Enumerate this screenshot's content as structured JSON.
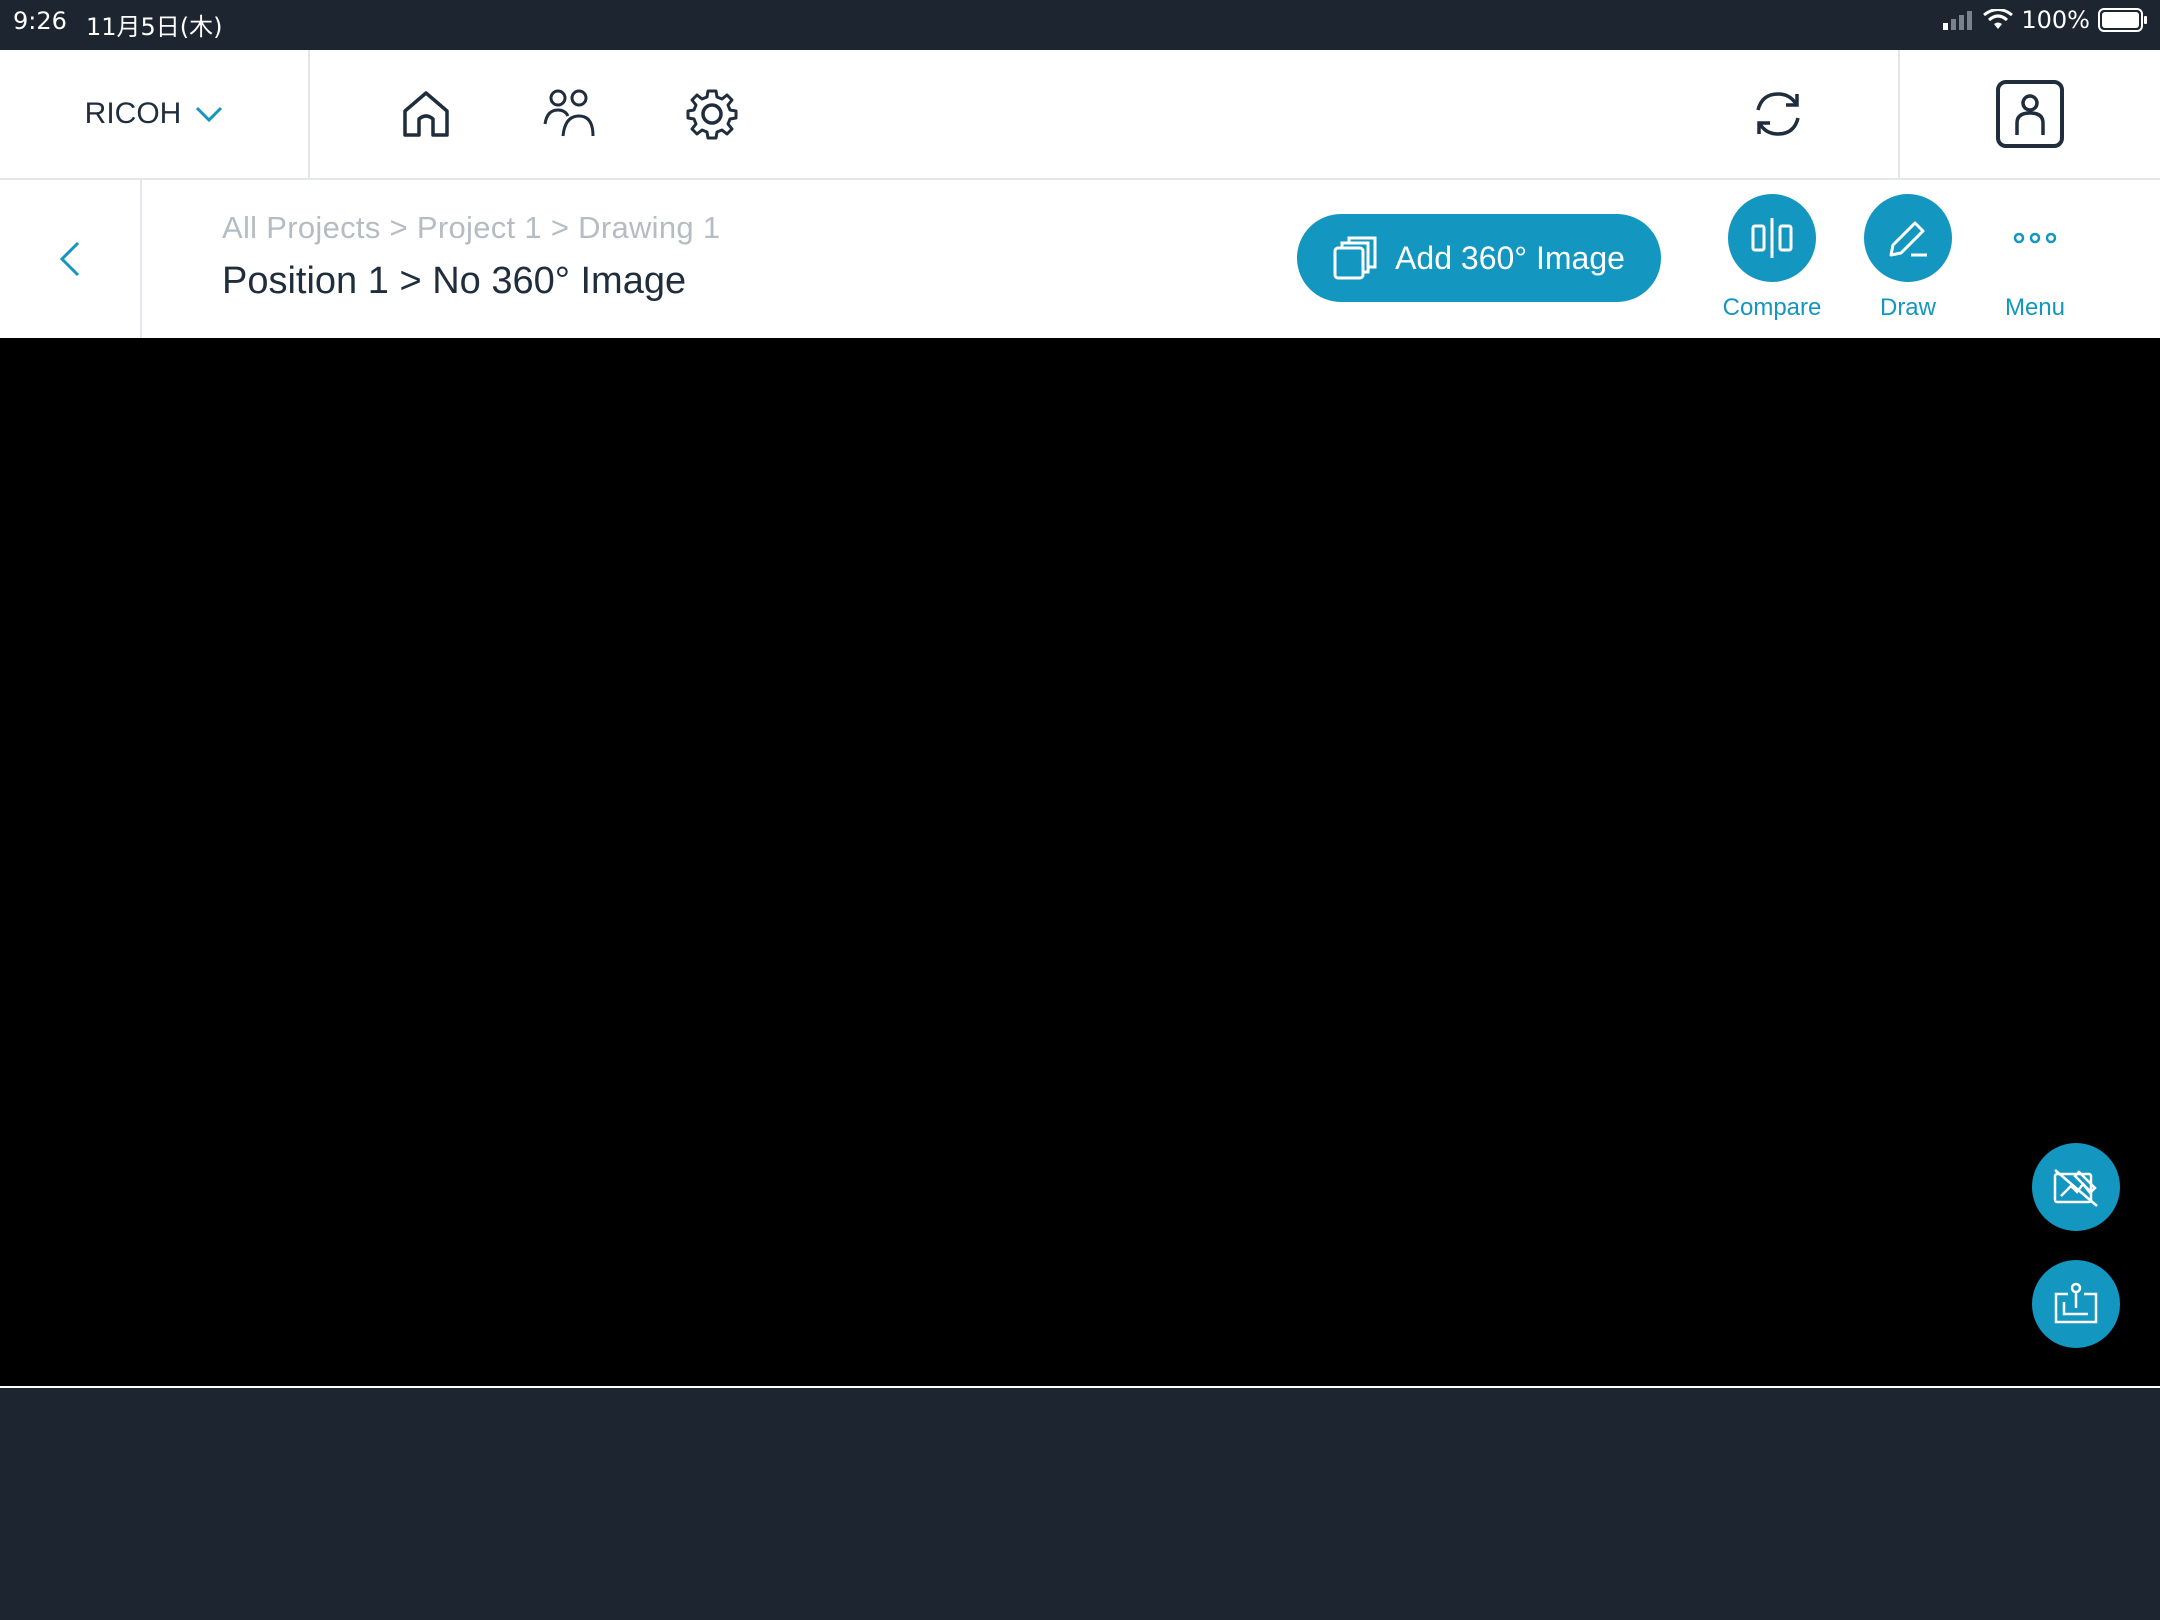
{
  "status_bar": {
    "time": "9:26",
    "date": "11月5日(木)",
    "battery": "100%"
  },
  "header": {
    "brand": "RICOH",
    "nav_icons": [
      "home-icon",
      "people-icon",
      "gear-icon"
    ],
    "sync_icon": "sync-icon",
    "profile_icon": "profile-icon"
  },
  "subheader": {
    "breadcrumb": "All Projects > Project 1 > Drawing 1",
    "title": "Position 1 > No 360° Image",
    "add_button": "Add 360° Image",
    "tools": {
      "compare": "Compare",
      "draw": "Draw",
      "menu": "Menu"
    }
  },
  "viewer": {
    "fab_icons": [
      "hide-markup-icon",
      "floor-plan-pin-icon"
    ]
  },
  "colors": {
    "accent": "#1396bf",
    "text_dark": "#1f2d3d",
    "text_muted": "#b5bcc4",
    "chrome_dark": "#1c2530"
  }
}
